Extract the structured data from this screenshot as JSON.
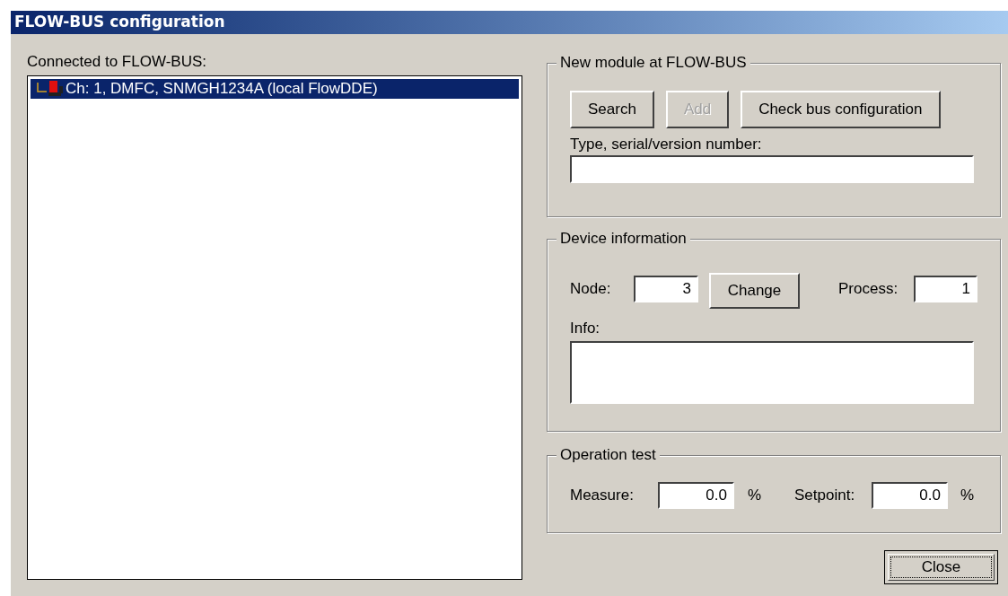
{
  "window": {
    "title": "FLOW-BUS configuration"
  },
  "bus_tree": {
    "label": "Connected to FLOW-BUS:",
    "items": [
      {
        "label": "Ch: 1, DMFC, SNMGH1234A (local FlowDDE)",
        "selected": true
      }
    ]
  },
  "new_module": {
    "title": "New module at FLOW-BUS",
    "buttons": [
      {
        "label": "Search",
        "disabled": false
      },
      {
        "label": "Add",
        "disabled": true
      },
      {
        "label": "Check bus configuration",
        "disabled": false
      }
    ],
    "field_label": "Type, serial/version number:"
  },
  "device_information": {
    "title": "Device information",
    "node_label": "Node:",
    "node_value": "3",
    "change_button": "Change",
    "process_label": "Process:",
    "process_value": "1",
    "info_label": "Info:"
  },
  "operation_test": {
    "title": "Operation test",
    "measure_label": "Measure:",
    "measure_value": "0.0",
    "measure_unit": "%",
    "setpoint_label": "Setpoint:",
    "setpoint_value": "0.0",
    "setpoint_unit": "%"
  },
  "close_button": "Close"
}
